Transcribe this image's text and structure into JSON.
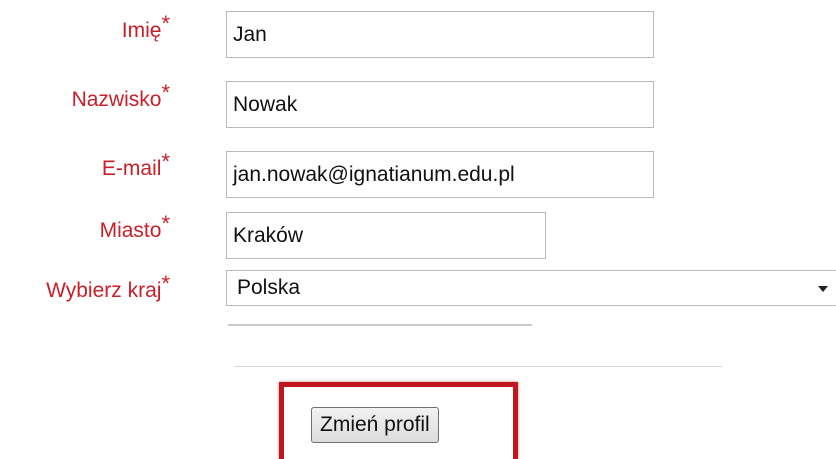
{
  "form": {
    "required_marker": "*",
    "fields": [
      {
        "label": "Imię",
        "value": "Jan"
      },
      {
        "label": "Nazwisko",
        "value": "Nowak"
      },
      {
        "label": "E-mail",
        "value": "jan.nowak@ignatianum.edu.pl"
      },
      {
        "label": "Miasto",
        "value": "Kraków"
      }
    ],
    "country": {
      "label": "Wybierz kraj",
      "selected": "Polska"
    },
    "submit_label": "Zmień profil"
  },
  "colors": {
    "label": "#c8202a",
    "highlight_border": "#c1151f"
  }
}
